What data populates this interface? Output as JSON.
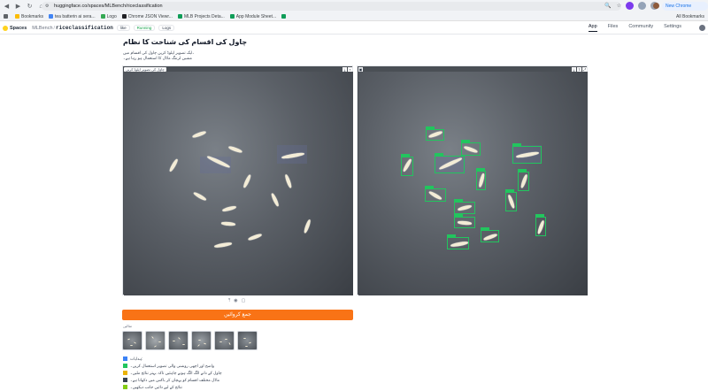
{
  "browser": {
    "url": "huggingface.co/spaces/MLBench/riceclassification",
    "update_label": "New Chrome available",
    "bookmarks": [
      "Bookmarks",
      "tea batterin ai sera...",
      "Logo",
      "Chrome JSON Viewr...",
      "MLB Projects Deta...",
      "App Module Sheet..."
    ],
    "all_bookmarks": "All Bookmarks"
  },
  "hf": {
    "spaces_label": "Spaces",
    "owner": "MLBench",
    "repo": "riceclassification",
    "like_label": "like",
    "running_label": "Running",
    "logs_label": "Logs",
    "tabs": [
      "App",
      "Files",
      "Community",
      "Settings"
    ]
  },
  "app": {
    "title": "چاول کی اقسام کی شناخت کا نظام",
    "desc_line1": "ایک تصویر اپلوڈ کریں چاول کی اقسام میں،",
    "desc_line2": "مشین لرننگ ماڈل کا استعمال ہو رہا ہے۔",
    "input_label": "چاول کی تصویر اپلوڈ کریں",
    "submit_label": "جمع کروائیں",
    "examples_label": "مثالیں",
    "notes": [
      "ہدایات:",
      "واضح اور اچھی روشنی والی تصویر استعمال کریں۔",
      "چاول کے دانے الگ الگ ہونے چاہئیں تاکہ بہتر نتائج ملیں۔",
      "ماڈل مختلف اقسام کو پہچان کر باکس میں دکھاتا ہے۔",
      "نتائج کے لیے دائیں جانب دیکھیں۔"
    ]
  },
  "colors": {
    "accent": "#f97316",
    "bbox": "#22c55e"
  }
}
